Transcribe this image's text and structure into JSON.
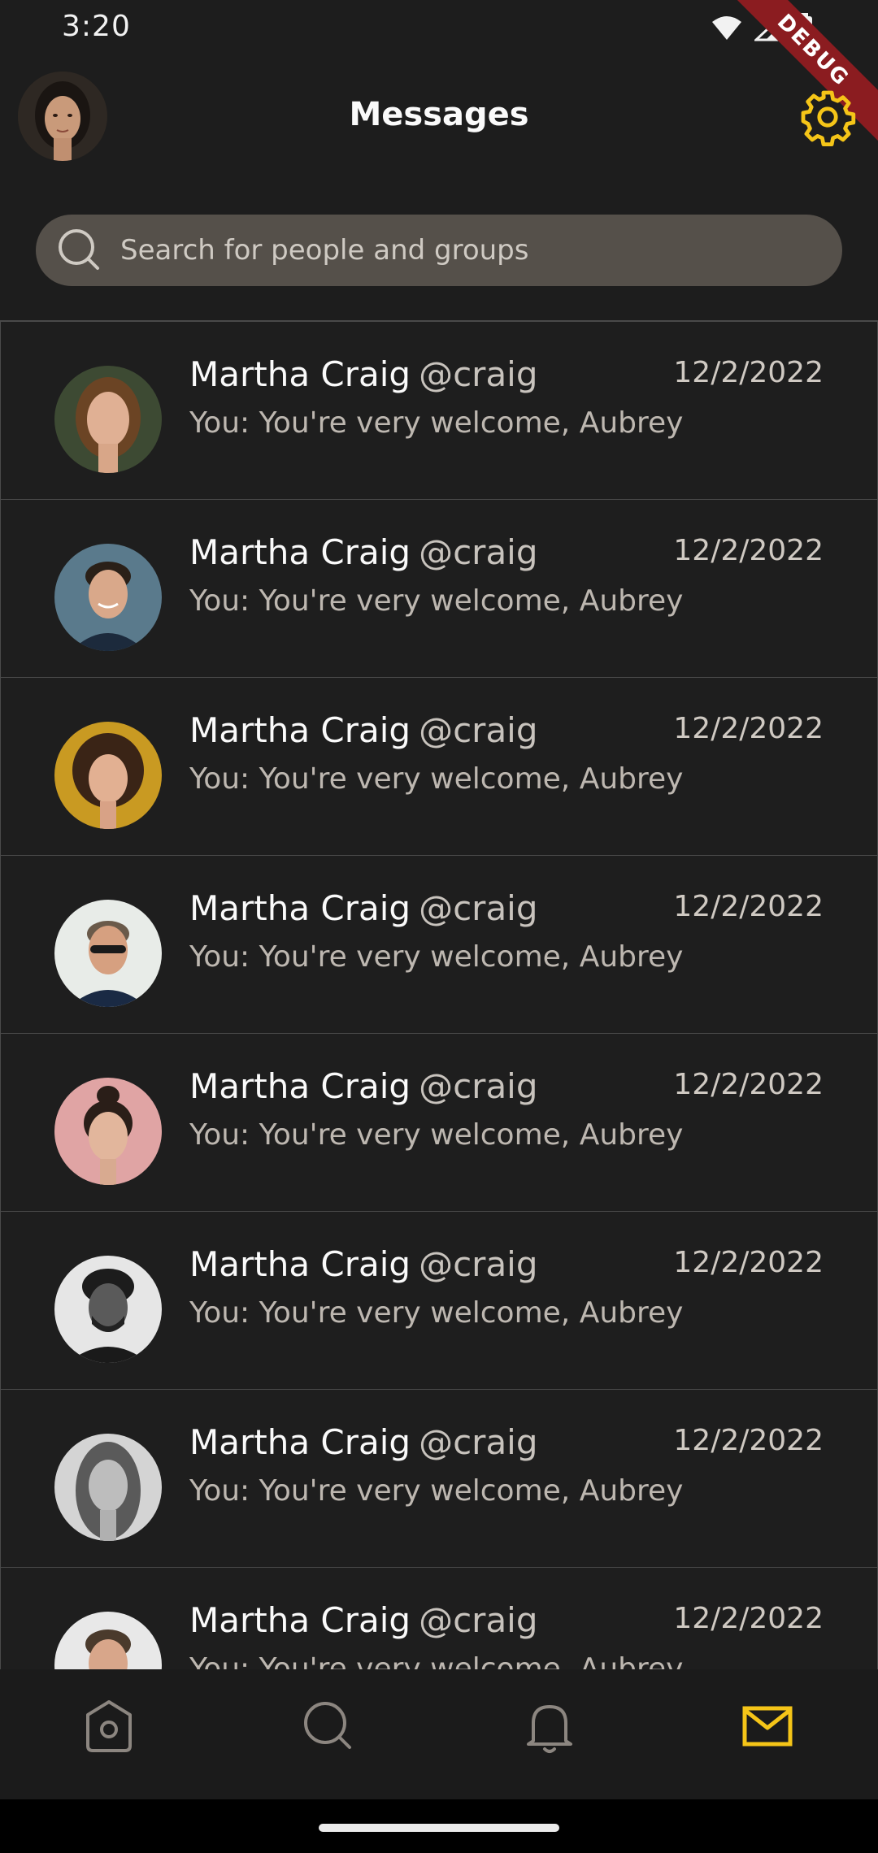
{
  "status_bar": {
    "time": "3:20"
  },
  "debug_banner": "DEBUG",
  "header": {
    "title": "Messages"
  },
  "search": {
    "placeholder": "Search for people and groups"
  },
  "colors": {
    "accent": "#f5c518",
    "background": "#1d1d1d",
    "search_bg": "#55504a",
    "divider": "#4a4a4a"
  },
  "messages": [
    {
      "name": "Martha Craig",
      "handle": "@craig",
      "date": "12/2/2022",
      "preview": "You: You're very welcome, Aubrey"
    },
    {
      "name": "Martha Craig",
      "handle": "@craig",
      "date": "12/2/2022",
      "preview": "You: You're very welcome, Aubrey"
    },
    {
      "name": "Martha Craig",
      "handle": "@craig",
      "date": "12/2/2022",
      "preview": "You: You're very welcome, Aubrey"
    },
    {
      "name": "Martha Craig",
      "handle": "@craig",
      "date": "12/2/2022",
      "preview": "You: You're very welcome, Aubrey"
    },
    {
      "name": "Martha Craig",
      "handle": "@craig",
      "date": "12/2/2022",
      "preview": "You: You're very welcome, Aubrey"
    },
    {
      "name": "Martha Craig",
      "handle": "@craig",
      "date": "12/2/2022",
      "preview": "You: You're very welcome, Aubrey"
    },
    {
      "name": "Martha Craig",
      "handle": "@craig",
      "date": "12/2/2022",
      "preview": "You: You're very welcome, Aubrey"
    },
    {
      "name": "Martha Craig",
      "handle": "@craig",
      "date": "12/2/2022",
      "preview": "You: You're very welcome, Aubrey"
    }
  ],
  "bottom_nav": [
    {
      "icon": "home-icon",
      "active": false
    },
    {
      "icon": "search-icon",
      "active": false
    },
    {
      "icon": "bell-icon",
      "active": false
    },
    {
      "icon": "mail-icon",
      "active": true
    }
  ]
}
